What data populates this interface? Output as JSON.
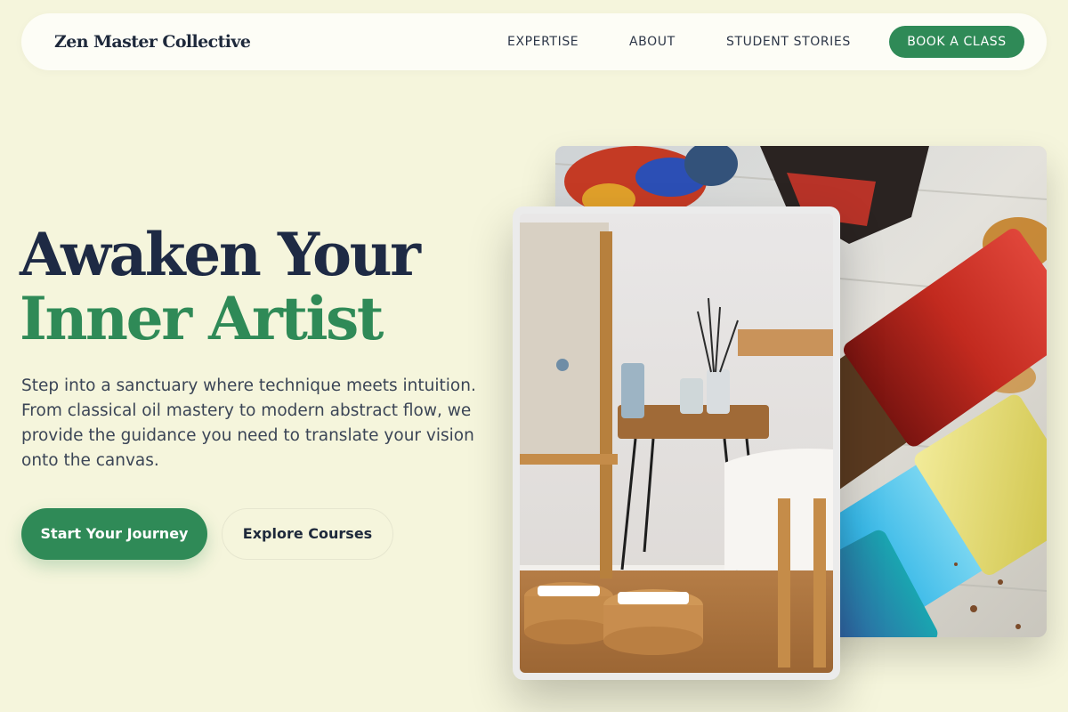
{
  "nav": {
    "brand": "Zen Master Collective",
    "links": [
      "EXPERTISE",
      "ABOUT",
      "STUDENT STORIES"
    ],
    "cta": "BOOK A CLASS"
  },
  "hero": {
    "headline_line1": "Awaken Your",
    "headline_line2": "Inner Artist",
    "description": "Step into a sanctuary where technique meets intuition. From classical oil mastery to modern abstract flow, we provide the guidance you need to translate your vision onto the canvas.",
    "primary_cta": "Start Your Journey",
    "secondary_cta": "Explore Courses"
  },
  "images": {
    "back": "paint-brushes-photo",
    "front": "art-studio-photo"
  },
  "colors": {
    "background": "#f5f5dc",
    "accent": "#2f8a57",
    "heading": "#1e2a44",
    "body_text": "#3b4556"
  }
}
